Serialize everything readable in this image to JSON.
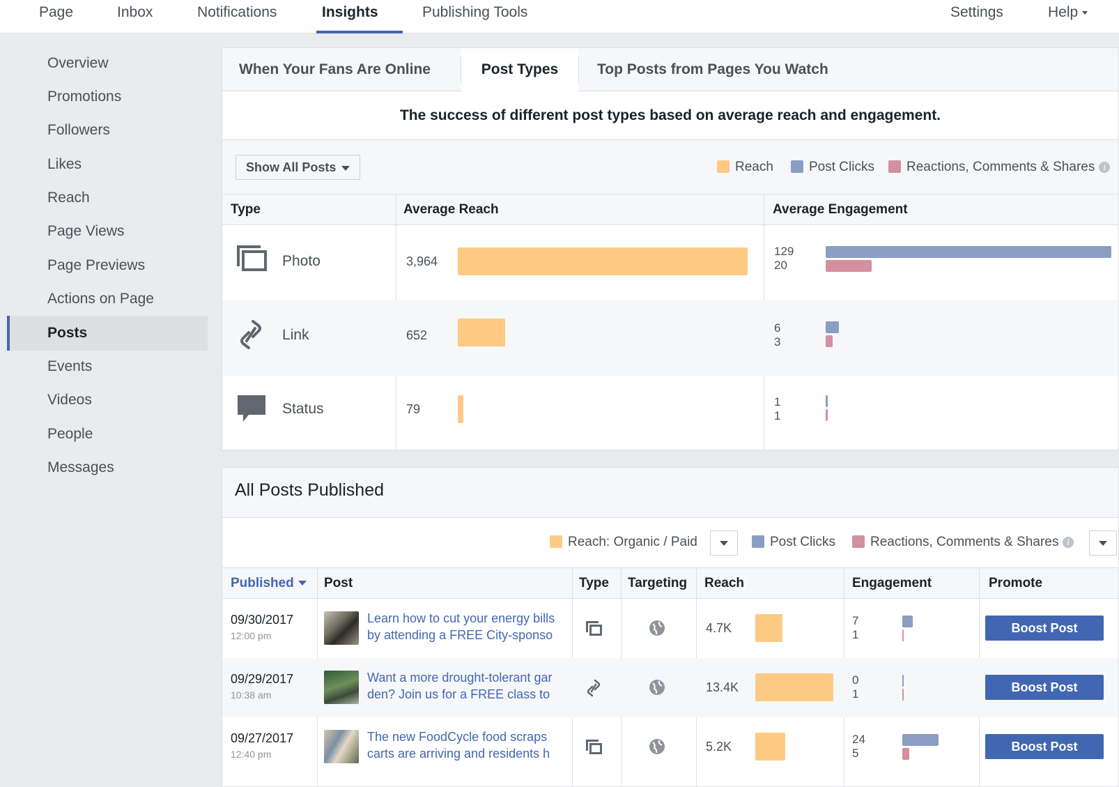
{
  "topnav": {
    "items": [
      "Page",
      "Inbox",
      "Notifications",
      "Insights",
      "Publishing Tools"
    ],
    "settings": "Settings",
    "help": "Help"
  },
  "sidebar": {
    "items": [
      "Overview",
      "Promotions",
      "Followers",
      "Likes",
      "Reach",
      "Page Views",
      "Page Previews",
      "Actions on Page",
      "Posts",
      "Events",
      "Videos",
      "People",
      "Messages"
    ],
    "active": "Posts"
  },
  "post_types": {
    "tabs": [
      "When Your Fans Are Online",
      "Post Types",
      "Top Posts from Pages You Watch"
    ],
    "subtitle": "The success of different post types based on average reach and engagement.",
    "filter_button": "Show All Posts",
    "legend": [
      "Reach",
      "Post Clicks",
      "Reactions, Comments & Shares"
    ],
    "columns": [
      "Type",
      "Average Reach",
      "Average Engagement"
    ],
    "rows": [
      {
        "type": "Photo",
        "icon": "photo-icon",
        "reach_label": "3,964",
        "reach": 3964,
        "clicks_label": "129",
        "clicks": 129,
        "reactions_label": "20",
        "reactions": 20
      },
      {
        "type": "Link",
        "icon": "link-icon",
        "reach_label": "652",
        "reach": 652,
        "clicks_label": "6",
        "clicks": 6,
        "reactions_label": "3",
        "reactions": 3
      },
      {
        "type": "Status",
        "icon": "status-icon",
        "reach_label": "79",
        "reach": 79,
        "clicks_label": "1",
        "clicks": 1,
        "reactions_label": "1",
        "reactions": 1
      }
    ]
  },
  "all_posts": {
    "title": "All Posts Published",
    "legend_reach": "Reach: Organic / Paid",
    "legend_clicks": "Post Clicks",
    "legend_reactions": "Reactions, Comments & Shares",
    "columns": [
      "Published",
      "Post",
      "Type",
      "Targeting",
      "Reach",
      "Engagement",
      "Promote"
    ],
    "rows": [
      {
        "date": "09/30/2017",
        "time": "12:00 pm",
        "line1": "Learn how to cut your energy bills",
        "line2": "by attending a FREE City-sponso",
        "type_icon": "photo-icon",
        "reach_label": "4.7K",
        "reach": 4700,
        "clicks_label": "7",
        "clicks": 7,
        "reactions_label": "1",
        "reactions": 1,
        "promote": "Boost Post"
      },
      {
        "date": "09/29/2017",
        "time": "10:38 am",
        "line1": "Want a more drought-tolerant gar",
        "line2": "den? Join us for a FREE class to",
        "type_icon": "link-icon",
        "reach_label": "13.4K",
        "reach": 13400,
        "clicks_label": "0",
        "clicks": 0,
        "reactions_label": "1",
        "reactions": 1,
        "promote": "Boost Post"
      },
      {
        "date": "09/27/2017",
        "time": "12:40 pm",
        "line1": "The new FoodCycle food scraps",
        "line2": "carts are arriving and residents h",
        "type_icon": "photo-icon",
        "reach_label": "5.2K",
        "reach": 5200,
        "clicks_label": "24",
        "clicks": 24,
        "reactions_label": "5",
        "reactions": 5,
        "promote": "Boost Post"
      }
    ]
  },
  "colors": {
    "reach": "#fdca84",
    "clicks": "#8b9dc3",
    "reactions": "#d48fa0",
    "accent": "#4267b2"
  }
}
